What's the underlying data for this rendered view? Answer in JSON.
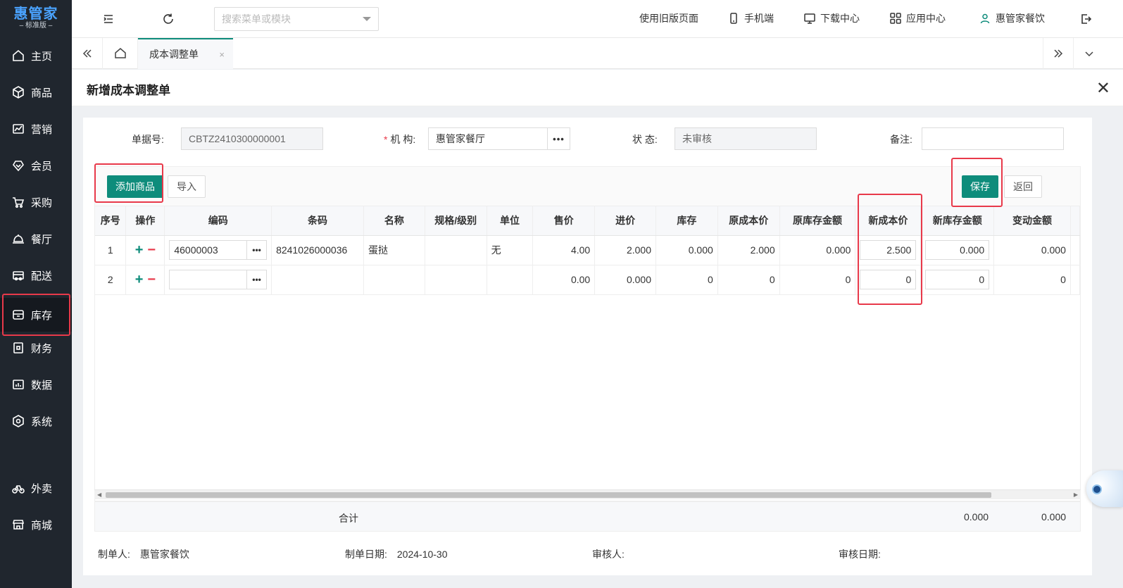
{
  "sidebar": {
    "logo_main": "惠管家",
    "logo_sub": "– 标准版 –",
    "items": [
      {
        "label": "主页",
        "icon": "home-icon"
      },
      {
        "label": "商品",
        "icon": "box-icon"
      },
      {
        "label": "营销",
        "icon": "chart-icon"
      },
      {
        "label": "会员",
        "icon": "diamond-icon"
      },
      {
        "label": "采购",
        "icon": "cart-icon"
      },
      {
        "label": "餐厅",
        "icon": "cloche-icon"
      },
      {
        "label": "配送",
        "icon": "truck-icon"
      },
      {
        "label": "库存",
        "icon": "archive-icon"
      },
      {
        "label": "财务",
        "icon": "finance-icon"
      },
      {
        "label": "数据",
        "icon": "data-icon"
      },
      {
        "label": "系统",
        "icon": "gear-icon"
      },
      {
        "label": "外卖",
        "icon": "bike-icon"
      },
      {
        "label": "商城",
        "icon": "store-icon"
      }
    ]
  },
  "header": {
    "search_placeholder": "搜索菜单或模块",
    "old_page": "使用旧版页面",
    "mobile": "手机端",
    "download": "下载中心",
    "apps": "应用中心",
    "user": "惠管家餐饮"
  },
  "tabs": {
    "active": "成本调整单",
    "close": "×"
  },
  "panel": {
    "title": "新增成本调整单",
    "close": "✕"
  },
  "form": {
    "doc_no_label": "单据号:",
    "doc_no_value": "CBTZ2410300000001",
    "org_label": "机 构:",
    "org_value": "惠管家餐厅",
    "status_label": "状 态:",
    "status_value": "未审核",
    "remark_label": "备注:",
    "remark_value": ""
  },
  "toolbar": {
    "add_label": "添加商品",
    "import_label": "导入",
    "save_label": "保存",
    "back_label": "返回"
  },
  "table": {
    "headers": [
      "序号",
      "操作",
      "编码",
      "条码",
      "名称",
      "规格/级别",
      "单位",
      "售价",
      "进价",
      "库存",
      "原成本价",
      "原库存金额",
      "新成本价",
      "新库存金额",
      "变动金额"
    ],
    "rows": [
      {
        "no": "1",
        "code": "46000003",
        "barcode": "8241026000036",
        "name": "蛋挞",
        "spec": "",
        "unit": "无",
        "price": "4.00",
        "purchase": "2.000",
        "stock": "0.000",
        "old_cost": "2.000",
        "old_amount": "0.000",
        "new_cost": "2.500",
        "new_amount": "0.000",
        "change": "0.000"
      },
      {
        "no": "2",
        "code": "",
        "barcode": "",
        "name": "",
        "spec": "",
        "unit": "",
        "price": "0.00",
        "purchase": "0.000",
        "stock": "0",
        "old_cost": "0",
        "old_amount": "0",
        "new_cost": "0",
        "new_amount": "0",
        "change": "0"
      }
    ],
    "totals_label": "合计",
    "total_new_amount": "0.000",
    "total_change": "0.000"
  },
  "footer": {
    "maker_label": "制单人:",
    "maker_value": "惠管家餐饮",
    "date_label": "制单日期:",
    "date_value": "2024-10-30",
    "auditor_label": "审核人:",
    "auditor_value": "",
    "audit_date_label": "审核日期:",
    "audit_date_value": ""
  },
  "colors": {
    "sidebar_bg": "#20262e",
    "accent": "#0e8c7b",
    "highlight": "#e8394a"
  }
}
